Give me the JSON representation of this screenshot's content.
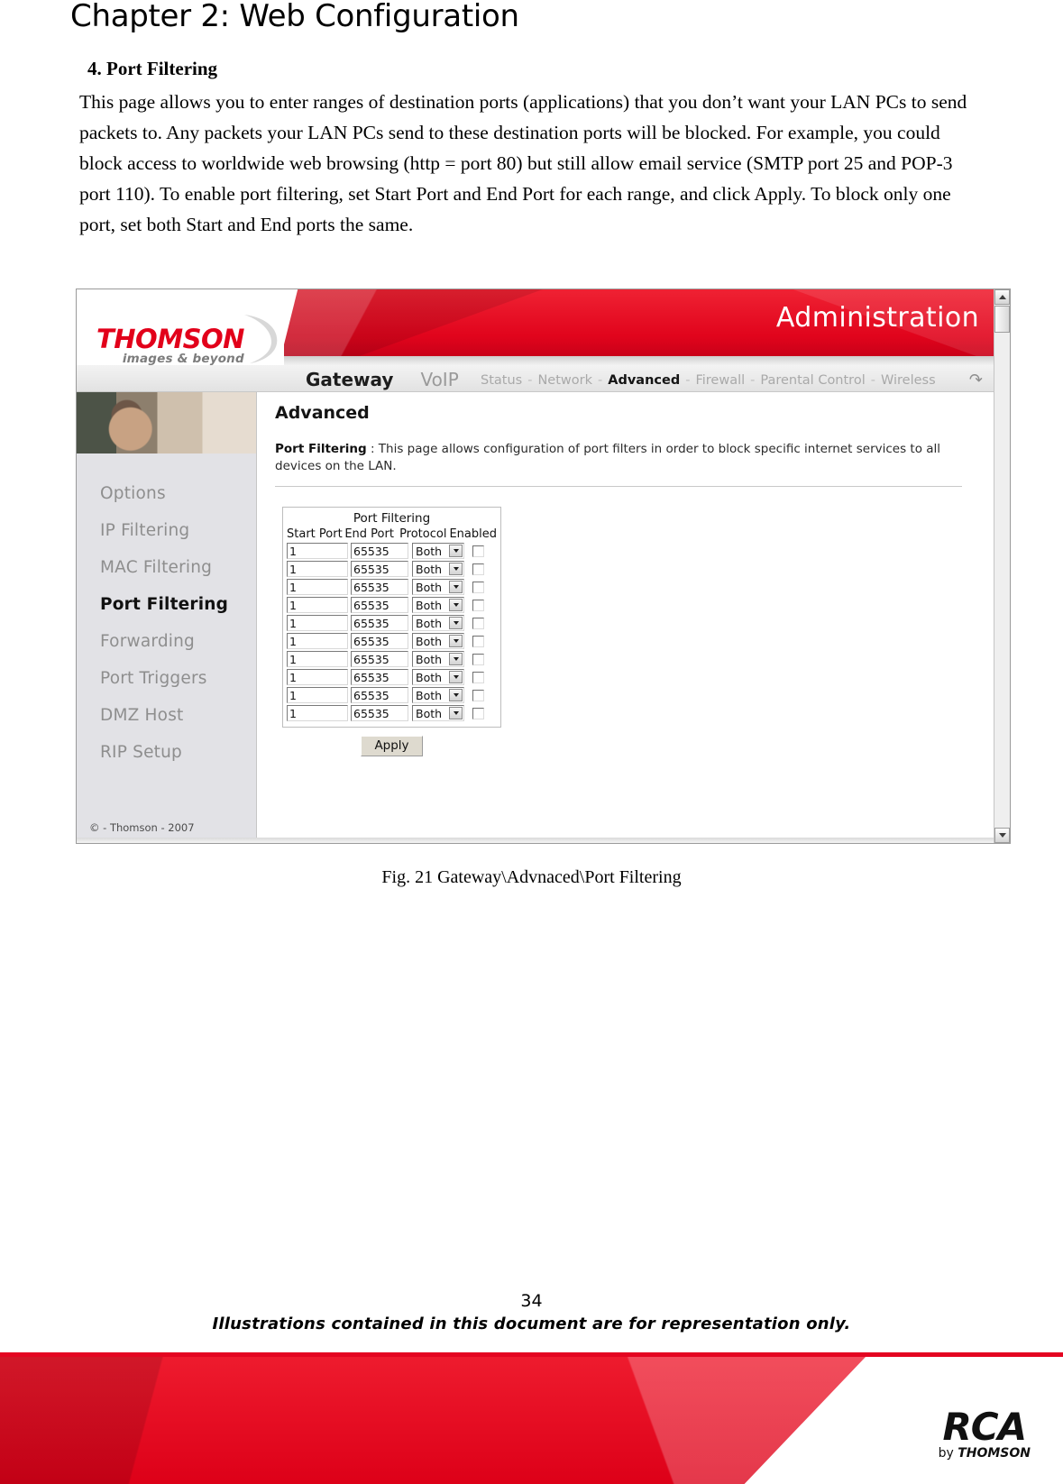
{
  "document": {
    "chapter_title": "Chapter 2: Web Configuration",
    "section_heading": "4. Port Filtering",
    "paragraph": "This page allows you to enter ranges of destination ports (applications) that you don’t want your LAN PCs to send packets to. Any packets your LAN PCs send to these destination ports will be blocked. For example, you could block access to worldwide web browsing (http = port 80) but still allow email service (SMTP port 25 and POP-3 port 110). To enable port filtering, set Start Port and End Port for each range, and click Apply. To block only one port, set both Start and End ports the same.",
    "figure_caption": "Fig. 21 Gateway\\Advnaced\\Port Filtering",
    "page_number": "34",
    "footer_note": "Illustrations contained in this document are for representation only.",
    "brand_mark": {
      "word": "RCA",
      "sub_prefix": "by ",
      "sub_brand": "THOMSON"
    }
  },
  "screenshot": {
    "logo": {
      "name": "THOMSON",
      "tagline": "images & beyond",
      "swoosh_icon": "swoosh-icon"
    },
    "banner_title": "Administration",
    "nav_main": [
      {
        "label": "Gateway",
        "active": true
      },
      {
        "label": "VoIP",
        "active": false
      }
    ],
    "nav_sub": [
      {
        "label": "Status",
        "active": false
      },
      {
        "label": "Network",
        "active": false
      },
      {
        "label": "Advanced",
        "active": true
      },
      {
        "label": "Firewall",
        "active": false
      },
      {
        "label": "Parental Control",
        "active": false
      },
      {
        "label": "Wireless",
        "active": false
      }
    ],
    "nav_separator": "-",
    "refresh_icon": "refresh-icon",
    "sidebar": {
      "items": [
        {
          "label": "Options",
          "active": false
        },
        {
          "label": "IP Filtering",
          "active": false
        },
        {
          "label": "MAC Filtering",
          "active": false
        },
        {
          "label": "Port Filtering",
          "active": true
        },
        {
          "label": "Forwarding",
          "active": false
        },
        {
          "label": "Port Triggers",
          "active": false
        },
        {
          "label": "DMZ Host",
          "active": false
        },
        {
          "label": "RIP Setup",
          "active": false
        }
      ],
      "copyright": "© - Thomson - 2007"
    },
    "content": {
      "heading": "Advanced",
      "desc_label": "Port Filtering",
      "desc_colon": ":",
      "desc_text": "This page allows configuration of port filters in order to block specific internet services to all devices on the LAN."
    },
    "table": {
      "title": "Port Filtering",
      "columns": [
        "Start Port",
        "End Port",
        "Protocol",
        "Enabled"
      ],
      "rows": [
        {
          "start_port": "1",
          "end_port": "65535",
          "protocol": "Both",
          "enabled": false
        },
        {
          "start_port": "1",
          "end_port": "65535",
          "protocol": "Both",
          "enabled": false
        },
        {
          "start_port": "1",
          "end_port": "65535",
          "protocol": "Both",
          "enabled": false
        },
        {
          "start_port": "1",
          "end_port": "65535",
          "protocol": "Both",
          "enabled": false
        },
        {
          "start_port": "1",
          "end_port": "65535",
          "protocol": "Both",
          "enabled": false
        },
        {
          "start_port": "1",
          "end_port": "65535",
          "protocol": "Both",
          "enabled": false
        },
        {
          "start_port": "1",
          "end_port": "65535",
          "protocol": "Both",
          "enabled": false
        },
        {
          "start_port": "1",
          "end_port": "65535",
          "protocol": "Both",
          "enabled": false
        },
        {
          "start_port": "1",
          "end_port": "65535",
          "protocol": "Both",
          "enabled": false
        },
        {
          "start_port": "1",
          "end_port": "65535",
          "protocol": "Both",
          "enabled": false
        }
      ]
    },
    "apply_button": "Apply",
    "colors": {
      "brand_red": "#e40521",
      "banner_red": "#e1041c",
      "sidebar_bg": "#e2e2e6",
      "active_text": "#111111",
      "muted_text": "#8e8e8e"
    }
  }
}
